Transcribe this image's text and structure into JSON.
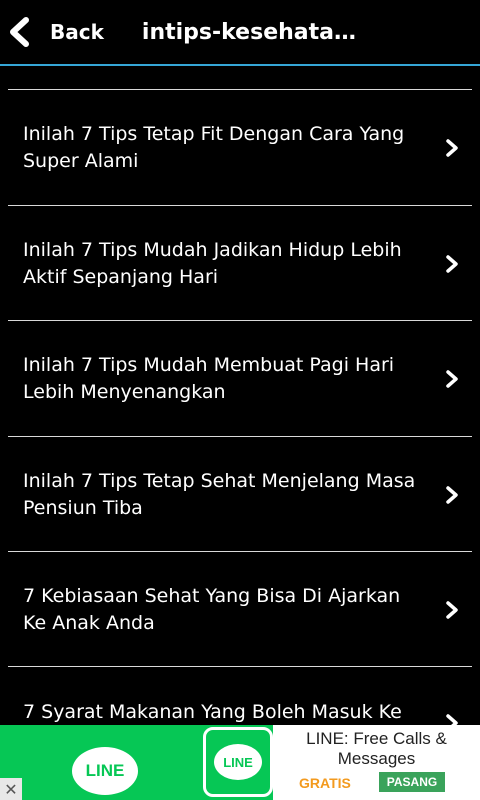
{
  "header": {
    "back_label": "Back",
    "title": "intips-kesehata...",
    "accent_color": "#35a6d6"
  },
  "list": {
    "items": [
      {
        "label": "Inilah 7 Tips Tetap Fit Dengan Cara Yang Super Alami"
      },
      {
        "label": "Inilah 7 Tips Mudah Jadikan Hidup Lebih Aktif Sepanjang Hari"
      },
      {
        "label": "Inilah 7 Tips Mudah Membuat Pagi Hari Lebih Menyenangkan"
      },
      {
        "label": "Inilah 7 Tips Tetap Sehat Menjelang Masa Pensiun Tiba"
      },
      {
        "label": "7 Kebiasaan Sehat Yang Bisa Di Ajarkan Ke Anak Anda"
      },
      {
        "label": "7 Syarat Makanan Yang Boleh Masuk Ke"
      }
    ]
  },
  "ad": {
    "brand": "LINE",
    "icon_label": "LINE",
    "title": "LINE: Free Calls & Messages",
    "price": "GRATIS",
    "install_label": "PASANG",
    "close_glyph": "✕",
    "brand_color": "#06c755"
  }
}
